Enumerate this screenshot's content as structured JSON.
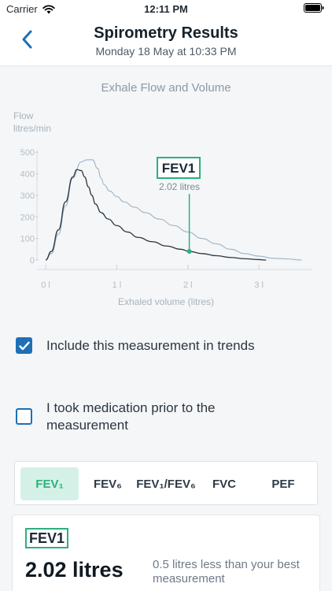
{
  "status_bar": {
    "carrier": "Carrier",
    "time": "12:11 PM"
  },
  "nav": {
    "title": "Spirometry Results",
    "subtitle": "Monday 18 May at 10:33 PM"
  },
  "chart_data": {
    "type": "line",
    "title": "Exhale Flow and Volume",
    "ylabel_line1": "Flow",
    "ylabel_line2": "litres/min",
    "xlabel": "Exhaled volume (litres)",
    "x_ticks": [
      "0 l",
      "1 l",
      "2 l",
      "3 l"
    ],
    "y_ticks": [
      "0",
      "100",
      "200",
      "300",
      "400",
      "500"
    ],
    "xlim": [
      0,
      3.75
    ],
    "ylim": [
      0,
      530
    ],
    "series": [
      {
        "x": [
          0,
          0.08,
          0.18,
          0.28,
          0.38,
          0.5,
          0.58,
          0.66,
          0.73,
          0.78,
          0.82,
          0.9,
          1.0,
          1.1,
          1.25,
          1.4,
          1.6,
          1.8,
          2.0,
          2.2,
          2.4,
          2.6,
          2.8,
          3.0,
          3.2,
          3.4,
          3.6
        ],
        "y": [
          0,
          30,
          120,
          250,
          380,
          455,
          465,
          465,
          425,
          380,
          350,
          320,
          295,
          270,
          245,
          220,
          190,
          160,
          130,
          100,
          75,
          50,
          30,
          18,
          8,
          5,
          0
        ],
        "color": "#9fb3c4"
      },
      {
        "x": [
          0,
          0.08,
          0.18,
          0.28,
          0.38,
          0.44,
          0.5,
          0.55,
          0.6,
          0.65,
          0.7,
          0.78,
          0.88,
          1.0,
          1.15,
          1.3,
          1.5,
          1.7,
          1.9,
          2.02,
          2.2,
          2.4,
          2.6,
          2.8,
          3.0,
          3.1
        ],
        "y": [
          0,
          40,
          140,
          270,
          385,
          420,
          415,
          385,
          340,
          300,
          260,
          220,
          190,
          160,
          130,
          105,
          85,
          65,
          50,
          40,
          30,
          20,
          12,
          6,
          2,
          0
        ],
        "color": "#2b3640"
      }
    ],
    "marker": {
      "label": "FEV1",
      "value_text": "2.02 litres",
      "x": 2.02,
      "y": 40,
      "color": "#2cb07e"
    }
  },
  "options": {
    "trends": {
      "label": "Include this measurement in trends",
      "checked": true
    },
    "medication": {
      "label": "I took medication prior to the measurement",
      "checked": false
    }
  },
  "tabs": [
    "FEV₁",
    "FEV₆",
    "FEV₁/FEV₆",
    "FVC",
    "PEF"
  ],
  "active_tab": "FEV₁",
  "result": {
    "badge": "FEV1",
    "value": "2.02 litres",
    "note": "0.5 litres less than your best measurement"
  },
  "colors": {
    "accent_blue": "#1f6fb5",
    "accent_green": "#2cb07e",
    "tab_active_bg": "#d5f1e7"
  }
}
